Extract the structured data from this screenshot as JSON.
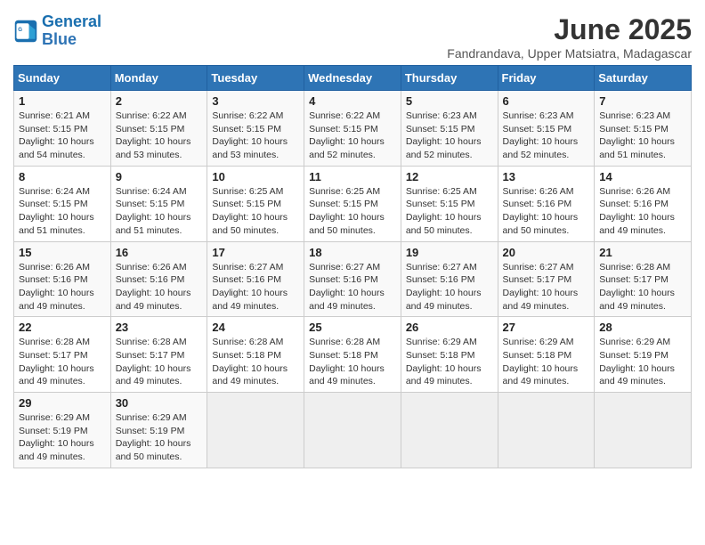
{
  "header": {
    "logo_line1": "General",
    "logo_line2": "Blue",
    "month": "June 2025",
    "location": "Fandrandava, Upper Matsiatra, Madagascar"
  },
  "days_of_week": [
    "Sunday",
    "Monday",
    "Tuesday",
    "Wednesday",
    "Thursday",
    "Friday",
    "Saturday"
  ],
  "weeks": [
    [
      {
        "day": "1",
        "sunrise": "6:21 AM",
        "sunset": "5:15 PM",
        "daylight": "10 hours and 54 minutes."
      },
      {
        "day": "2",
        "sunrise": "6:22 AM",
        "sunset": "5:15 PM",
        "daylight": "10 hours and 53 minutes."
      },
      {
        "day": "3",
        "sunrise": "6:22 AM",
        "sunset": "5:15 PM",
        "daylight": "10 hours and 53 minutes."
      },
      {
        "day": "4",
        "sunrise": "6:22 AM",
        "sunset": "5:15 PM",
        "daylight": "10 hours and 52 minutes."
      },
      {
        "day": "5",
        "sunrise": "6:23 AM",
        "sunset": "5:15 PM",
        "daylight": "10 hours and 52 minutes."
      },
      {
        "day": "6",
        "sunrise": "6:23 AM",
        "sunset": "5:15 PM",
        "daylight": "10 hours and 52 minutes."
      },
      {
        "day": "7",
        "sunrise": "6:23 AM",
        "sunset": "5:15 PM",
        "daylight": "10 hours and 51 minutes."
      }
    ],
    [
      {
        "day": "8",
        "sunrise": "6:24 AM",
        "sunset": "5:15 PM",
        "daylight": "10 hours and 51 minutes."
      },
      {
        "day": "9",
        "sunrise": "6:24 AM",
        "sunset": "5:15 PM",
        "daylight": "10 hours and 51 minutes."
      },
      {
        "day": "10",
        "sunrise": "6:25 AM",
        "sunset": "5:15 PM",
        "daylight": "10 hours and 50 minutes."
      },
      {
        "day": "11",
        "sunrise": "6:25 AM",
        "sunset": "5:15 PM",
        "daylight": "10 hours and 50 minutes."
      },
      {
        "day": "12",
        "sunrise": "6:25 AM",
        "sunset": "5:15 PM",
        "daylight": "10 hours and 50 minutes."
      },
      {
        "day": "13",
        "sunrise": "6:26 AM",
        "sunset": "5:16 PM",
        "daylight": "10 hours and 50 minutes."
      },
      {
        "day": "14",
        "sunrise": "6:26 AM",
        "sunset": "5:16 PM",
        "daylight": "10 hours and 49 minutes."
      }
    ],
    [
      {
        "day": "15",
        "sunrise": "6:26 AM",
        "sunset": "5:16 PM",
        "daylight": "10 hours and 49 minutes."
      },
      {
        "day": "16",
        "sunrise": "6:26 AM",
        "sunset": "5:16 PM",
        "daylight": "10 hours and 49 minutes."
      },
      {
        "day": "17",
        "sunrise": "6:27 AM",
        "sunset": "5:16 PM",
        "daylight": "10 hours and 49 minutes."
      },
      {
        "day": "18",
        "sunrise": "6:27 AM",
        "sunset": "5:16 PM",
        "daylight": "10 hours and 49 minutes."
      },
      {
        "day": "19",
        "sunrise": "6:27 AM",
        "sunset": "5:16 PM",
        "daylight": "10 hours and 49 minutes."
      },
      {
        "day": "20",
        "sunrise": "6:27 AM",
        "sunset": "5:17 PM",
        "daylight": "10 hours and 49 minutes."
      },
      {
        "day": "21",
        "sunrise": "6:28 AM",
        "sunset": "5:17 PM",
        "daylight": "10 hours and 49 minutes."
      }
    ],
    [
      {
        "day": "22",
        "sunrise": "6:28 AM",
        "sunset": "5:17 PM",
        "daylight": "10 hours and 49 minutes."
      },
      {
        "day": "23",
        "sunrise": "6:28 AM",
        "sunset": "5:17 PM",
        "daylight": "10 hours and 49 minutes."
      },
      {
        "day": "24",
        "sunrise": "6:28 AM",
        "sunset": "5:18 PM",
        "daylight": "10 hours and 49 minutes."
      },
      {
        "day": "25",
        "sunrise": "6:28 AM",
        "sunset": "5:18 PM",
        "daylight": "10 hours and 49 minutes."
      },
      {
        "day": "26",
        "sunrise": "6:29 AM",
        "sunset": "5:18 PM",
        "daylight": "10 hours and 49 minutes."
      },
      {
        "day": "27",
        "sunrise": "6:29 AM",
        "sunset": "5:18 PM",
        "daylight": "10 hours and 49 minutes."
      },
      {
        "day": "28",
        "sunrise": "6:29 AM",
        "sunset": "5:19 PM",
        "daylight": "10 hours and 49 minutes."
      }
    ],
    [
      {
        "day": "29",
        "sunrise": "6:29 AM",
        "sunset": "5:19 PM",
        "daylight": "10 hours and 49 minutes."
      },
      {
        "day": "30",
        "sunrise": "6:29 AM",
        "sunset": "5:19 PM",
        "daylight": "10 hours and 50 minutes."
      },
      null,
      null,
      null,
      null,
      null
    ]
  ]
}
